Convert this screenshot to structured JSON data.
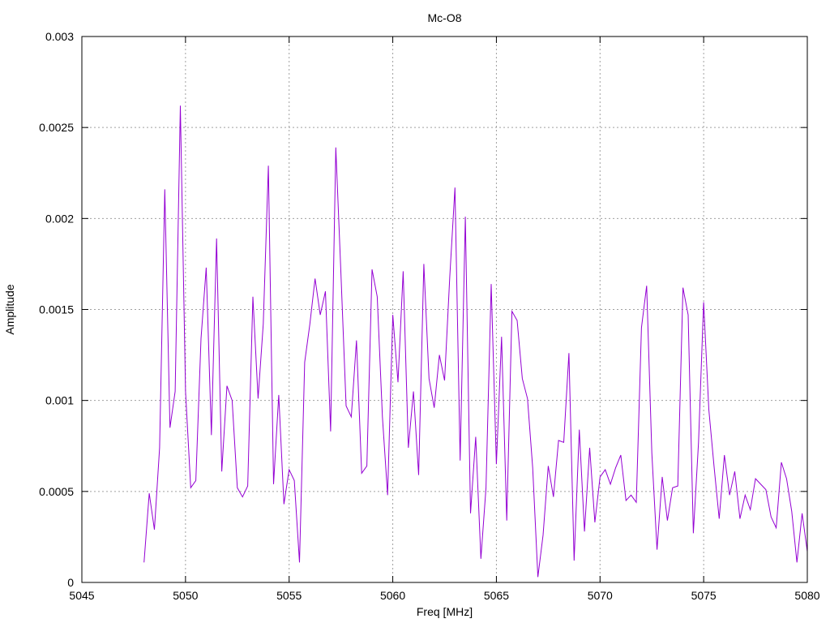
{
  "chart_data": {
    "type": "line",
    "title": "Mc-O8",
    "xlabel": "Freq [MHz]",
    "ylabel": "Amplitude",
    "xlim": [
      5045,
      5080
    ],
    "ylim": [
      0,
      0.003
    ],
    "xticks": [
      5045,
      5050,
      5055,
      5060,
      5065,
      5070,
      5075,
      5080
    ],
    "xtick_labels": [
      "5045",
      "5050",
      "5055",
      "5060",
      "5065",
      "5070",
      "5075",
      "5080"
    ],
    "yticks": [
      0,
      0.0005,
      0.001,
      0.0015,
      0.002,
      0.0025,
      0.003
    ],
    "ytick_labels": [
      "0",
      "0.0005",
      "0.001",
      "0.0015",
      "0.002",
      "0.0025",
      "0.003"
    ],
    "grid": true,
    "series": [
      {
        "color": "#9400d3",
        "x": [
          5048.0,
          5048.25,
          5048.5,
          5048.75,
          5049.0,
          5049.25,
          5049.5,
          5049.75,
          5050.0,
          5050.25,
          5050.5,
          5050.75,
          5051.0,
          5051.25,
          5051.5,
          5051.75,
          5052.0,
          5052.25,
          5052.5,
          5052.75,
          5053.0,
          5053.25,
          5053.5,
          5053.75,
          5054.0,
          5054.25,
          5054.5,
          5054.75,
          5055.0,
          5055.25,
          5055.5,
          5055.75,
          5056.0,
          5056.25,
          5056.5,
          5056.75,
          5057.0,
          5057.25,
          5057.5,
          5057.75,
          5058.0,
          5058.25,
          5058.5,
          5058.75,
          5059.0,
          5059.25,
          5059.5,
          5059.75,
          5060.0,
          5060.25,
          5060.5,
          5060.75,
          5061.0,
          5061.25,
          5061.5,
          5061.75,
          5062.0,
          5062.25,
          5062.5,
          5062.75,
          5063.0,
          5063.25,
          5063.5,
          5063.75,
          5064.0,
          5064.25,
          5064.5,
          5064.75,
          5065.0,
          5065.25,
          5065.5,
          5065.75,
          5066.0,
          5066.25,
          5066.5,
          5066.75,
          5067.0,
          5067.25,
          5067.5,
          5067.75,
          5068.0,
          5068.25,
          5068.5,
          5068.75,
          5069.0,
          5069.25,
          5069.5,
          5069.75,
          5070.0,
          5070.25,
          5070.5,
          5070.75,
          5071.0,
          5071.25,
          5071.5,
          5071.75,
          5072.0,
          5072.25,
          5072.5,
          5072.75,
          5073.0,
          5073.25,
          5073.5,
          5073.75,
          5074.0,
          5074.25,
          5074.5,
          5074.75,
          5075.0,
          5075.25,
          5075.5,
          5075.75,
          5076.0,
          5076.25,
          5076.5,
          5076.75,
          5077.0,
          5077.25,
          5077.5,
          5077.75,
          5078.0,
          5078.25,
          5078.5,
          5078.75,
          5079.0,
          5079.25,
          5079.5,
          5079.75,
          5080.0
        ],
        "y": [
          0.00011,
          0.00049,
          0.00029,
          0.00074,
          0.00216,
          0.00085,
          0.00105,
          0.00262,
          0.00105,
          0.00052,
          0.00056,
          0.00134,
          0.00173,
          0.00081,
          0.00189,
          0.00061,
          0.00108,
          0.001,
          0.00052,
          0.00047,
          0.00053,
          0.00157,
          0.00101,
          0.00142,
          0.00229,
          0.00054,
          0.00103,
          0.00043,
          0.00062,
          0.00056,
          0.00011,
          0.00121,
          0.00142,
          0.00167,
          0.00147,
          0.0016,
          0.00083,
          0.00239,
          0.0017,
          0.00097,
          0.00091,
          0.00133,
          0.0006,
          0.00064,
          0.00172,
          0.00157,
          0.00091,
          0.00048,
          0.00147,
          0.0011,
          0.00171,
          0.00074,
          0.00105,
          0.00059,
          0.00175,
          0.00112,
          0.00096,
          0.00125,
          0.00111,
          0.00168,
          0.00217,
          0.00067,
          0.00201,
          0.00038,
          0.0008,
          0.00013,
          0.00052,
          0.00164,
          0.00065,
          0.00135,
          0.00034,
          0.00149,
          0.00144,
          0.00112,
          0.00101,
          0.00063,
          3e-05,
          0.00026,
          0.00064,
          0.00047,
          0.00078,
          0.00077,
          0.00126,
          0.00012,
          0.00084,
          0.00028,
          0.00074,
          0.00033,
          0.00058,
          0.00062,
          0.00054,
          0.00063,
          0.0007,
          0.00045,
          0.00048,
          0.00044,
          0.0014,
          0.00163,
          0.00071,
          0.00018,
          0.00058,
          0.00034,
          0.00052,
          0.00053,
          0.00162,
          0.00147,
          0.00027,
          0.00077,
          0.00154,
          0.00095,
          0.00064,
          0.00035,
          0.0007,
          0.00048,
          0.00061,
          0.00035,
          0.00048,
          0.0004,
          0.00057,
          0.00054,
          0.00051,
          0.00036,
          0.0003,
          0.00066,
          0.00057,
          0.00039,
          0.00011,
          0.00038,
          0.00017
        ]
      }
    ]
  }
}
